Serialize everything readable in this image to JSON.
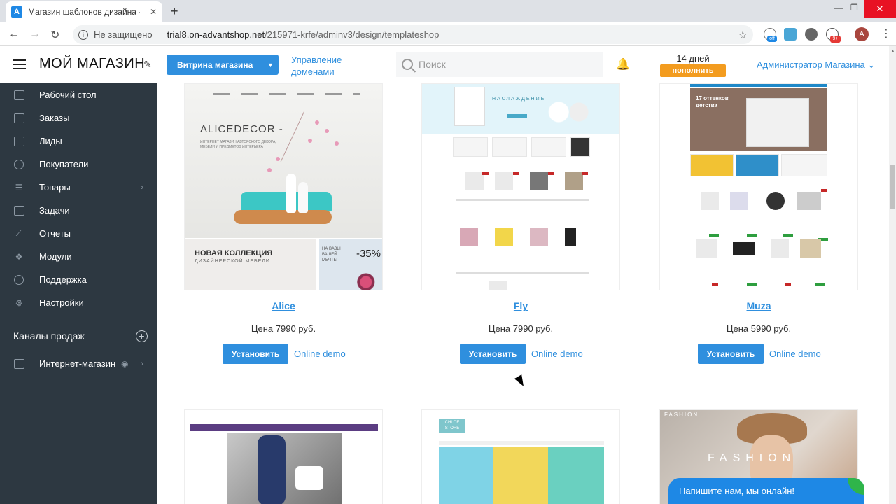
{
  "browser": {
    "tab_title": "Магазин шаблонов дизайна - М",
    "favicon_letter": "A",
    "insecure_label": "Не защищено",
    "url_host": "trial8.on-advantshop.net",
    "url_path": "/215971-krfe/adminv3/design/templateshop",
    "profile_letter": "A",
    "ext_badge_off": "off",
    "ext_badge_count": "9+"
  },
  "header": {
    "shop_title": "МОЙ МАГАЗИН",
    "storefront_label": "Витрина магазина",
    "domains_label": "Управление доменами",
    "search_placeholder": "Поиск",
    "trial_days": "14 дней",
    "topup_label": "пополнить",
    "admin_label": "Администратор Магазина"
  },
  "sidebar": {
    "items": [
      {
        "label": "Рабочий стол"
      },
      {
        "label": "Заказы"
      },
      {
        "label": "Лиды"
      },
      {
        "label": "Покупатели"
      },
      {
        "label": "Товары"
      },
      {
        "label": "Задачи"
      },
      {
        "label": "Отчеты"
      },
      {
        "label": "Модули"
      },
      {
        "label": "Поддержка"
      },
      {
        "label": "Настройки"
      }
    ],
    "channels_title": "Каналы продаж",
    "channel_item": "Интернет-магазин"
  },
  "templates": [
    {
      "name": "Alice",
      "price": "Цена 7990 руб.",
      "preview": {
        "brand": "ALICEDECOR -",
        "subtitle": "ИНТЕРНЕТ МАГАЗИН АВТОРСКОГО ДЕКОРА, МЕБЕЛИ И ПРЕДМЕТОВ ИНТЕРЬЕРА",
        "collection": "НОВАЯ КОЛЛЕКЦИЯ",
        "collection_sub": "ДИЗАЙНЕРСКОЙ МЕБЕЛИ",
        "sale_caption": "НА ВАЗЫ ВАШЕЙ МЕЧТЫ",
        "sale": "-35%"
      }
    },
    {
      "name": "Fly",
      "price": "Цена 7990 руб.",
      "preview": {
        "hero_text": "НАСЛАЖДЕНИЕ"
      }
    },
    {
      "name": "Muza",
      "price": "Цена 5990 руб.",
      "preview": {
        "hero_text": "17 оттенков детства"
      }
    }
  ],
  "templates_row2": [
    {
      "preview": {}
    },
    {
      "preview": {
        "logo": "CHLOE STORE"
      }
    },
    {
      "preview": {
        "small": "FASHION",
        "word": "FASHION"
      }
    }
  ],
  "actions": {
    "install_label": "Установить",
    "demo_label": "Online demo"
  },
  "chat": {
    "label": "Напишите нам, мы онлайн!"
  },
  "colors": {
    "accent": "#2f8fde",
    "sidebar": "#2d3841",
    "topup": "#f39c1f",
    "chat": "#1e88e5"
  },
  "icons": [
    "hamburger-icon",
    "pencil-icon",
    "search-icon",
    "bell-icon",
    "chevron-down-icon",
    "plus-circle-icon",
    "eye-icon"
  ]
}
